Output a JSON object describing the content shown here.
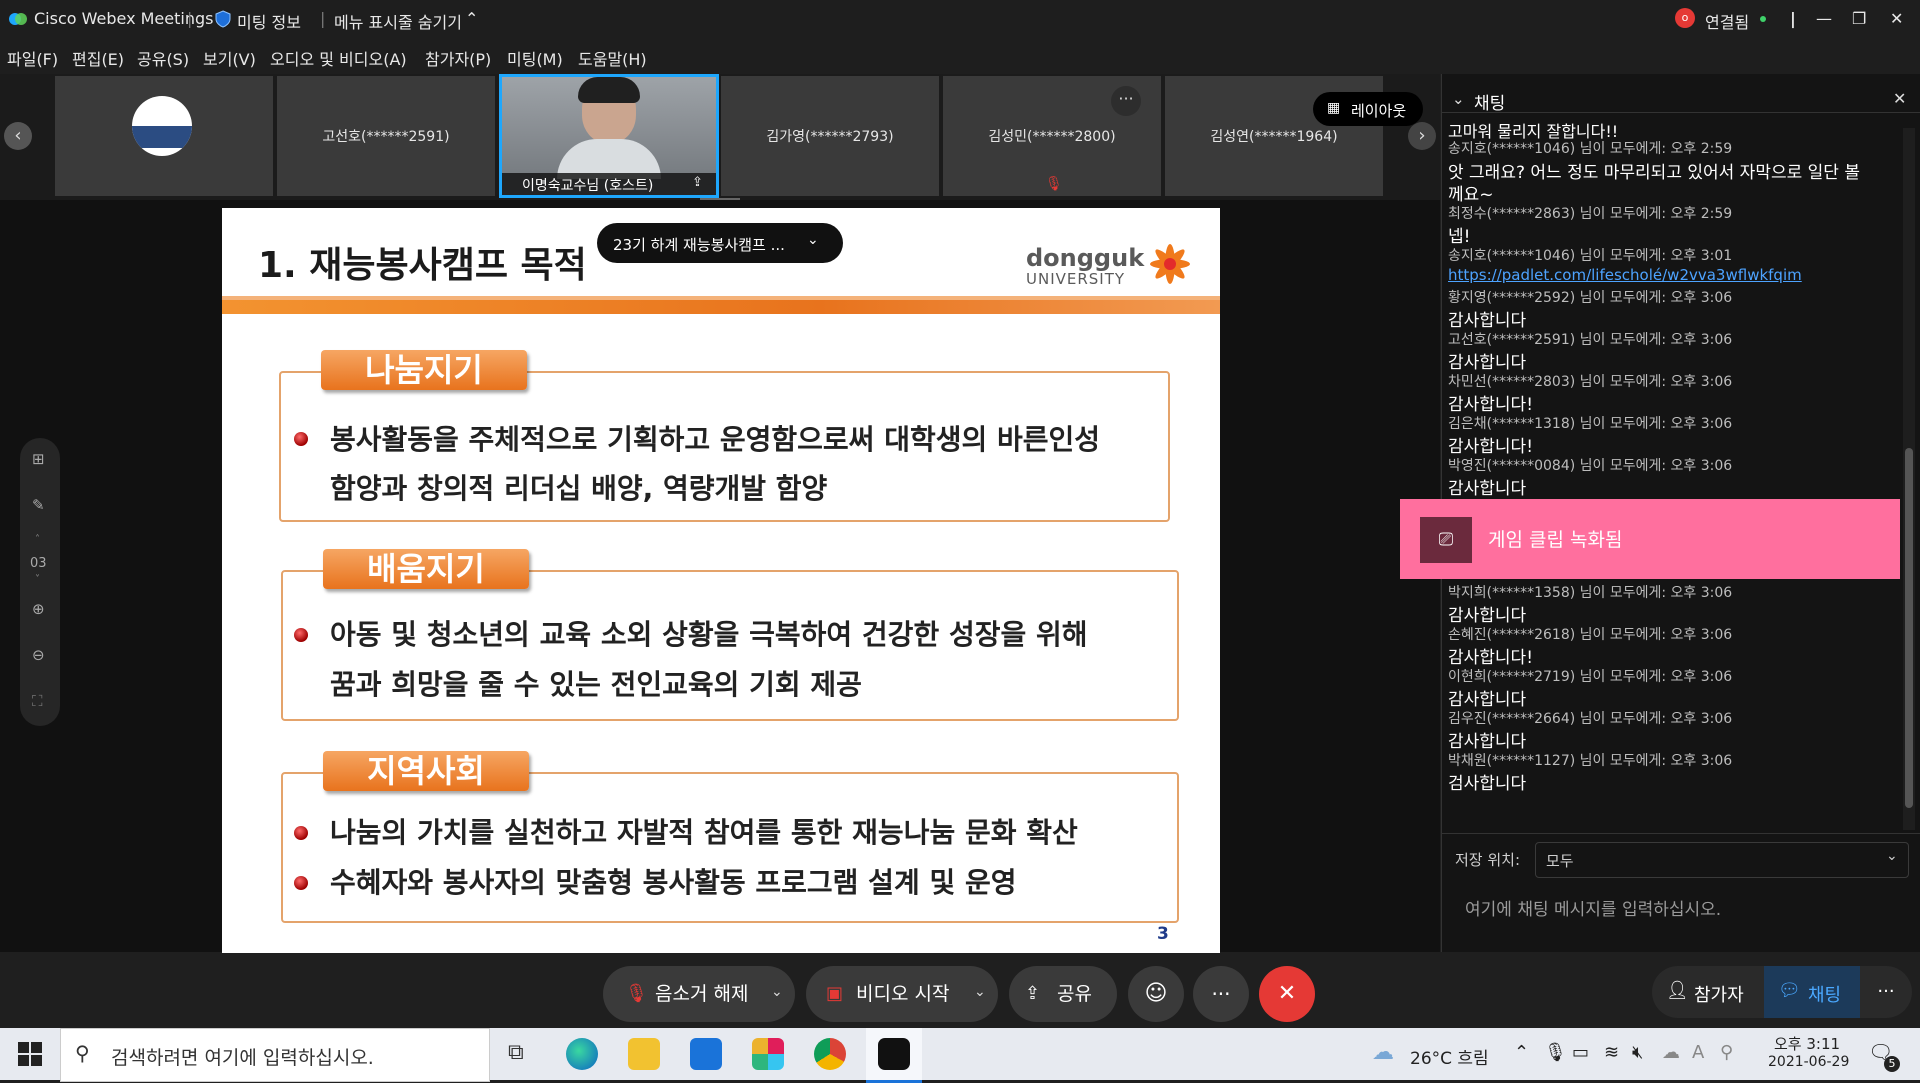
{
  "titlebar": {
    "app_name": "Cisco Webex Meetings",
    "meeting_info": "미팅 정보",
    "hide_menu": "메뉴 표시줄 숨기기",
    "connection_status": "연결됨"
  },
  "menu": [
    "파일(F)",
    "편집(E)",
    "공유(S)",
    "보기(V)",
    "오디오 및 비디오(A)",
    "참가자(P)",
    "미팅(M)",
    "도움말(H)"
  ],
  "filmstrip": {
    "tiles": [
      "고선호(******2591)",
      "이명숙교수님 (호스트)",
      "김가영(******2793)",
      "김성민(******2800)",
      "김성연(******1964)"
    ],
    "layout_button": "레이아웃"
  },
  "slide": {
    "title": "1. 재능봉사캠프 목적",
    "meeting_overlay": "23기 하계 재능봉사캠프 ...",
    "logo_line1": "dongguk",
    "logo_line2": "UNIVERSITY",
    "sections": [
      {
        "tab": "나눔지기",
        "lines": [
          "봉사활동을 주체적으로 기획하고 운영함으로써 대학생의 바른인성",
          "함양과 창의적 리더십 배양, 역량개발 함양"
        ]
      },
      {
        "tab": "배움지기",
        "lines": [
          "아동 및 청소년의 교육 소외 상황을 극복하여 건강한 성장을 위해",
          "꿈과 희망을 줄 수 있는 전인교육의 기회 제공"
        ]
      },
      {
        "tab": "지역사회",
        "lines": [
          "나눔의 가치를 실천하고 자발적 참여를 통한 재능나눔 문화 확산",
          "수혜자와 봉사자의 맞춤형 봉사활동 프로그램 설계 및 운영"
        ]
      }
    ],
    "page_number": "3",
    "page_indicator": "03"
  },
  "chat": {
    "title": "채팅",
    "messages": [
      {
        "header": "송지호(******1046) 님이 모두에게:    오후 2:59",
        "text": "앗 그래요? 어느 정도 마무리되고 있어서 자막으로 일단 볼",
        "text2": "께요~"
      },
      {
        "header": "최정수(******2863) 님이 모두에게:    오후 2:59",
        "text": "넵!"
      },
      {
        "header": "송지호(******1046) 님이 모두에게:    오후 3:01",
        "link": "https://padlet.com/lifescholé/w2vva3wflwkfqim"
      },
      {
        "header": "황지영(******2592) 님이 모두에게:    오후 3:06",
        "text": "감사합니다"
      },
      {
        "header": "고선호(******2591) 님이 모두에게:    오후 3:06",
        "text": "감사합니다"
      },
      {
        "header": "차민선(******2803) 님이 모두에게:    오후 3:06",
        "text": "감사합니다!"
      },
      {
        "header": "김은채(******1318) 님이 모두에게:    오후 3:06",
        "text": "감사합니다!"
      },
      {
        "header": "박영진(******0084) 님이 모두에게:    오후 3:06",
        "text": "감사합니다"
      },
      {
        "header": "박지희(******1358) 님이 모두에게:    오후 3:06",
        "text": "감사합니다"
      },
      {
        "header": "손혜진(******2618) 님이 모두에게:    오후 3:06",
        "text": "감사합니다!"
      },
      {
        "header": "이현희(******2719) 님이 모두에게:    오후 3:06",
        "text": "감사합니다"
      },
      {
        "header": "김우진(******2664) 님이 모두에게:    오후 3:06",
        "text": "감사합니다"
      },
      {
        "header": "박채원(******1127) 님이 모두에게:    오후 3:06",
        "text": "검사합니다"
      }
    ],
    "toast": "게임 클립 녹화됨",
    "send_to_label": "저장 위치:",
    "send_to_value": "모두",
    "input_placeholder": "여기에 채팅 메시지를 입력하십시오."
  },
  "controls": {
    "mute": "음소거 해제",
    "video": "비디오 시작",
    "share": "공유",
    "participants": "참가자",
    "chat": "채팅"
  },
  "taskbar": {
    "search_placeholder": "검색하려면 여기에 입력하십시오.",
    "weather": "26°C  흐림",
    "time": "오후 3:11",
    "date": "2021-06-29",
    "notifications": "5"
  },
  "colors": {
    "accent_orange": "#e8731d",
    "webex_blue": "#1ea7fd",
    "end_red": "#e53935",
    "toast_pink": "#ff6f9e"
  }
}
